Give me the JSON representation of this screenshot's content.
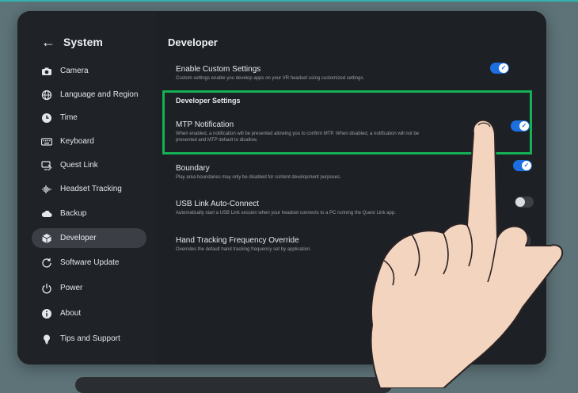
{
  "sidebar": {
    "back_title": "System",
    "items": [
      {
        "label": "Camera",
        "icon": "camera-icon"
      },
      {
        "label": "Language and Region",
        "icon": "globe-icon"
      },
      {
        "label": "Time",
        "icon": "clock-icon"
      },
      {
        "label": "Keyboard",
        "icon": "keyboard-icon"
      },
      {
        "label": "Quest Link",
        "icon": "link-icon"
      },
      {
        "label": "Headset Tracking",
        "icon": "tracking-icon"
      },
      {
        "label": "Backup",
        "icon": "cloud-icon"
      },
      {
        "label": "Developer",
        "icon": "cube-icon"
      },
      {
        "label": "Software Update",
        "icon": "update-icon"
      },
      {
        "label": "Power",
        "icon": "power-icon"
      },
      {
        "label": "About",
        "icon": "info-icon"
      },
      {
        "label": "Tips and Support",
        "icon": "lightbulb-icon"
      }
    ]
  },
  "main": {
    "title": "Developer",
    "custom": {
      "title": "Enable Custom Settings",
      "desc": "Custom settings enable you develop apps on your VR headset using customized settings.",
      "on": true
    },
    "section_title": "Developer Settings",
    "mtp": {
      "title": "MTP Notification",
      "desc1": "When enabled, a notification will be presented allowing you to confirm MTP. When disabled, a notification will not be",
      "desc2": "presented and MTP default to disallow.",
      "on": true
    },
    "boundary": {
      "title": "Boundary",
      "desc": "Play area boundaries may only be disabled for content development purposes.",
      "on": true
    },
    "usb": {
      "title": "USB Link Auto-Connect",
      "desc": "Automatically start a USB Link session when your headset connects to a PC running the Quest Link app.",
      "on": false
    },
    "hand": {
      "title": "Hand Tracking Frequency Override",
      "desc": "Overrides the default hand tracking frequency set by application."
    }
  },
  "colors": {
    "accent": "#1c6fe0",
    "highlight": "#16b055",
    "background": "#5d7378",
    "panel": "#1d2024"
  }
}
